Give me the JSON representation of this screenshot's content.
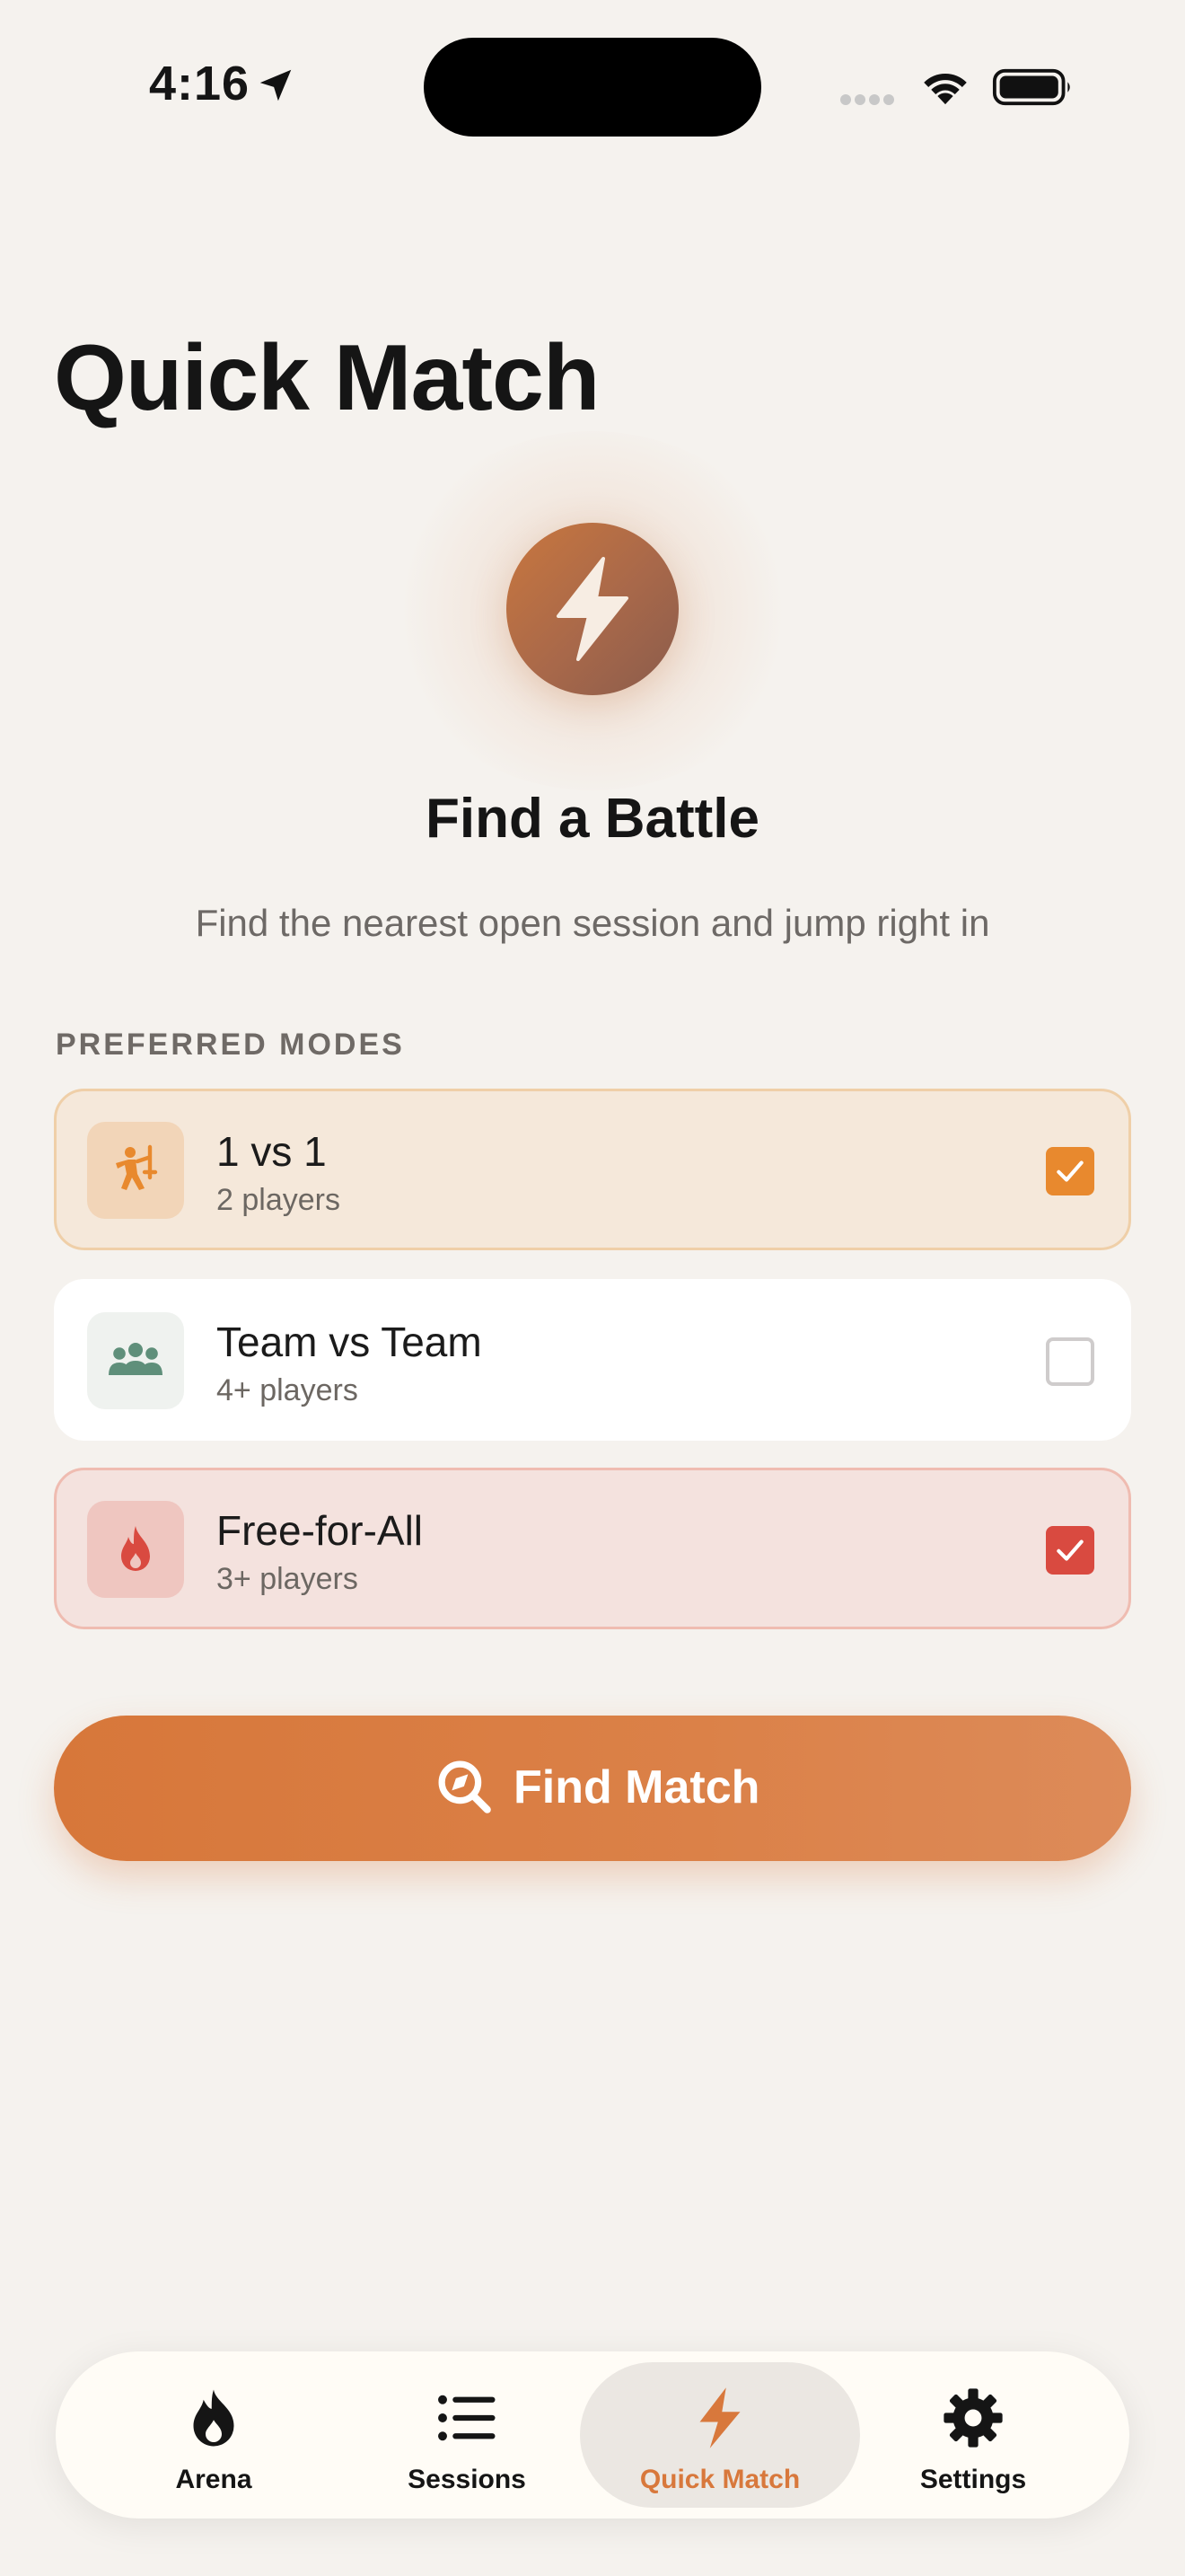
{
  "status_bar": {
    "time": "4:16",
    "icons": [
      "location-arrow-icon",
      "signal-icon",
      "wifi-icon",
      "battery-icon"
    ]
  },
  "page": {
    "title": "Quick Match"
  },
  "hero": {
    "icon": "lightning-bolt-icon",
    "title": "Find a Battle",
    "subtitle": "Find the nearest open session and jump right in"
  },
  "modes": {
    "section_label": "PREFERRED MODES",
    "items": [
      {
        "name": "1 vs 1",
        "players": "2 players",
        "icon": "duel-icon",
        "checked": true,
        "color": "#e8892e"
      },
      {
        "name": "Team vs Team",
        "players": "4+ players",
        "icon": "team-icon",
        "checked": false,
        "color": "#5f8f7a"
      },
      {
        "name": "Free-for-All",
        "players": "3+ players",
        "icon": "flame-icon",
        "checked": true,
        "color": "#d94a40"
      }
    ]
  },
  "find_button": {
    "label": "Find Match",
    "icon": "search-compass-icon"
  },
  "tab_bar": {
    "tabs": [
      {
        "label": "Arena",
        "icon": "flame-icon",
        "active": false
      },
      {
        "label": "Sessions",
        "icon": "list-icon",
        "active": false
      },
      {
        "label": "Quick Match",
        "icon": "lightning-bolt-icon",
        "active": true
      },
      {
        "label": "Settings",
        "icon": "gear-icon",
        "active": false
      }
    ]
  },
  "colors": {
    "accent": "#d8783c",
    "background": "#f5f2ee"
  }
}
